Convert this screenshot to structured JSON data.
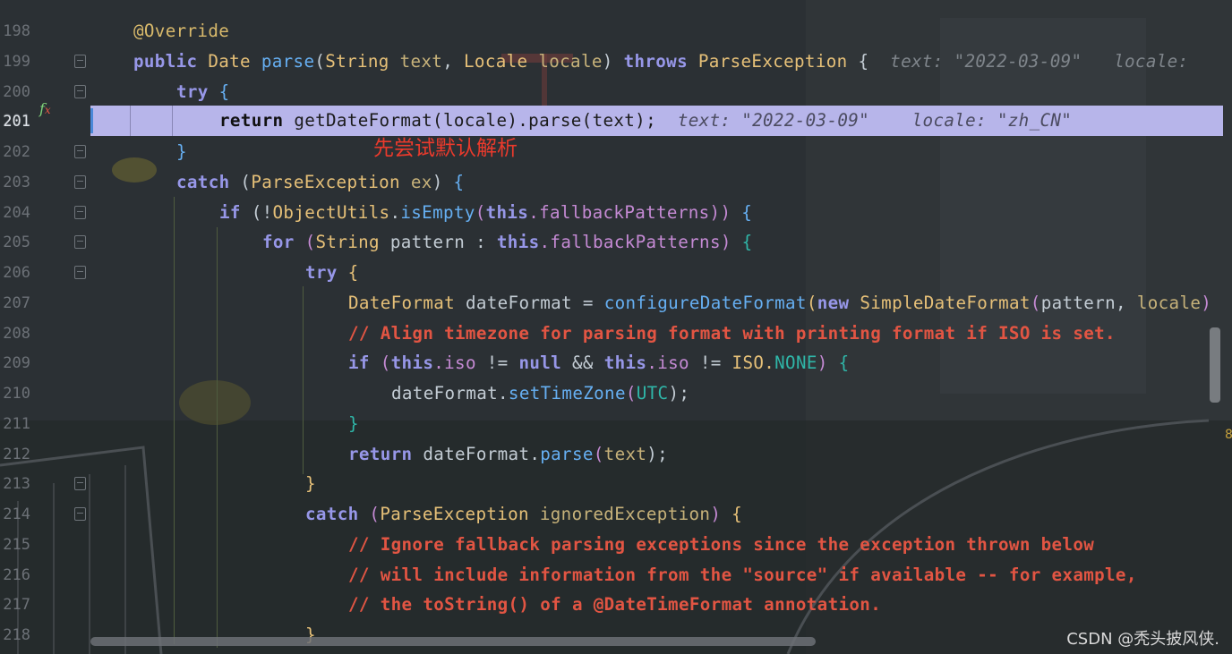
{
  "line_numbers": [
    "198",
    "199",
    "200",
    "201",
    "202",
    "203",
    "204",
    "205",
    "206",
    "207",
    "208",
    "209",
    "210",
    "211",
    "212",
    "213",
    "214",
    "215",
    "216",
    "217",
    "218"
  ],
  "code_lines": {
    "l198": {
      "annotation": "@Override"
    },
    "l199": {
      "public": "public",
      "date": "Date",
      "parse": "parse",
      "open": "(",
      "string": "String",
      "text_param": "text",
      "comma": ",",
      "locale_cls": "Locale",
      "locale_param": "locale",
      "close": ")",
      "throws": "throws",
      "exception": "ParseException",
      "brace": "{",
      "hint_text": "text: \"2022-03-09\"",
      "hint_locale": "locale:"
    },
    "l200": {
      "try": "try",
      "brace": "{"
    },
    "l201": {
      "return": "return",
      "rest": "getDateFormat(locale).parse(text);",
      "hint_text": "text: \"2022-03-09\"",
      "hint_locale": "locale: \"zh_CN\""
    },
    "l202": {
      "brace": "}"
    },
    "l203": {
      "catch": "catch",
      "open": "(",
      "exception": "ParseException",
      "ex": "ex",
      "close": ")",
      "brace": "{"
    },
    "l204": {
      "if": "if",
      "open": "(!",
      "utils": "ObjectUtils",
      "dot": ".",
      "isempty": "isEmpty",
      "paren": "(",
      "this": "this",
      "field": ".fallbackPatterns",
      "close": "))",
      "brace": "{"
    },
    "l205": {
      "for": "for",
      "open": "(",
      "string": "String",
      "pattern": "pattern",
      "colon": ":",
      "this": "this",
      "field": ".fallbackPatterns",
      "close": ")",
      "brace": "{"
    },
    "l206": {
      "try": "try",
      "brace": "{"
    },
    "l207": {
      "type": "DateFormat",
      "var": "dateFormat",
      "eq": "=",
      "fn": "configureDateFormat",
      "paren": "(",
      "new": "new",
      "cls": "SimpleDateFormat",
      "args_open": "(",
      "pattern": "pattern",
      "comma": ",",
      "locale": "locale",
      "end": ")"
    },
    "l208": {
      "comment": "// Align timezone for parsing format with printing format if ISO is set."
    },
    "l209": {
      "if": "if",
      "open": "(",
      "this1": "this",
      "iso1": ".iso",
      "ne": "!=",
      "null": "null",
      "and": "&&",
      "this2": "this",
      "iso2": ".iso",
      "ne2": "!=",
      "iso_cls": "ISO.",
      "none": "NONE",
      "close": ")",
      "brace": "{"
    },
    "l210": {
      "var": "dateFormat.",
      "fn": "setTimeZone",
      "open": "(",
      "utc": "UTC",
      "close": ");"
    },
    "l211": {
      "brace": "}"
    },
    "l212": {
      "return": "return",
      "var": "dateFormat.",
      "fn": "parse",
      "open": "(",
      "text": "text",
      "close": ");"
    },
    "l213": {
      "brace": "}"
    },
    "l214": {
      "catch": "catch",
      "open": "(",
      "exception": "ParseException",
      "var": "ignoredException",
      "close": ")",
      "brace": "{"
    },
    "l215": {
      "comment": "// Ignore fallback parsing exceptions since the exception thrown below"
    },
    "l216": {
      "comment": "// will include information from the \"source\" if available -- for example,"
    },
    "l217": {
      "comment": "// the toString() of a @DateTimeFormat annotation."
    },
    "l218": {
      "brace": "}"
    }
  },
  "annotation_note": "先尝试默认解析",
  "watermark": "CSDN @秃头披风侠.",
  "gutter_icon": "f",
  "gutter_icon_sub": "x",
  "colors": {
    "highlight": "#b7b5ea",
    "keyword": "#9797e8",
    "comment": "#e25543",
    "method": "#66aff2",
    "class": "#e6c078"
  }
}
